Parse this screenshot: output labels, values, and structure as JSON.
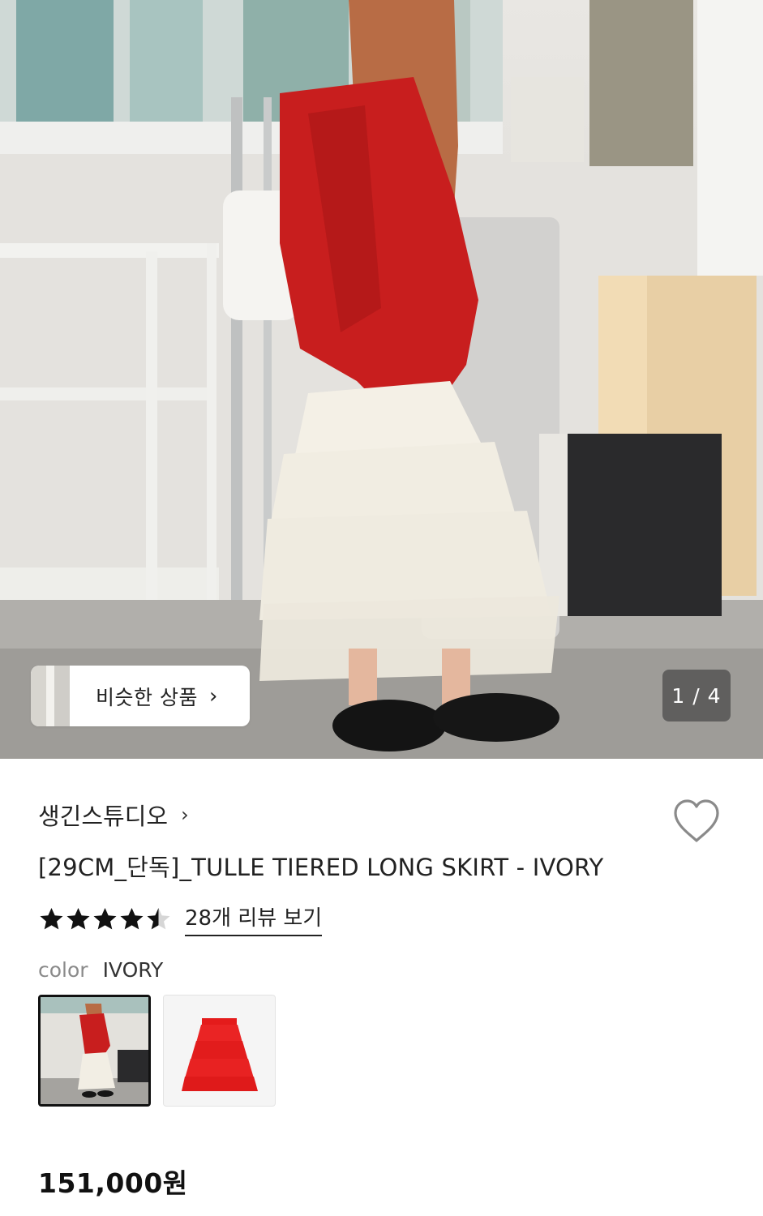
{
  "gallery": {
    "similar_button_label": "비슷한 상품",
    "similar_button_chevron": "›",
    "counter": "1 / 4",
    "current_index": 1,
    "total": 4
  },
  "product": {
    "brand": "생긴스튜디오",
    "brand_chevron": "›",
    "title": "[29CM_단독]_TULLE TIERED LONG SKIRT - IVORY",
    "rating": 4.5,
    "review_link": "28개 리뷰 보기",
    "color_label": "color",
    "color_value": "IVORY",
    "price": "151,000원",
    "favorite": false
  },
  "swatches": [
    {
      "name": "IVORY",
      "selected": true,
      "icon": "ivory-skirt-photo"
    },
    {
      "name": "RED",
      "selected": false,
      "icon": "red-skirt-photo"
    }
  ],
  "colors": {
    "jacket_red": "#c81e1e",
    "skirt_ivory": "#f4f0e6",
    "text": "#222222",
    "muted": "#8a8a8a"
  },
  "icons": {
    "heart": "heart-outline-icon",
    "chevron": "chevron-right-icon",
    "star": "star-icon"
  }
}
